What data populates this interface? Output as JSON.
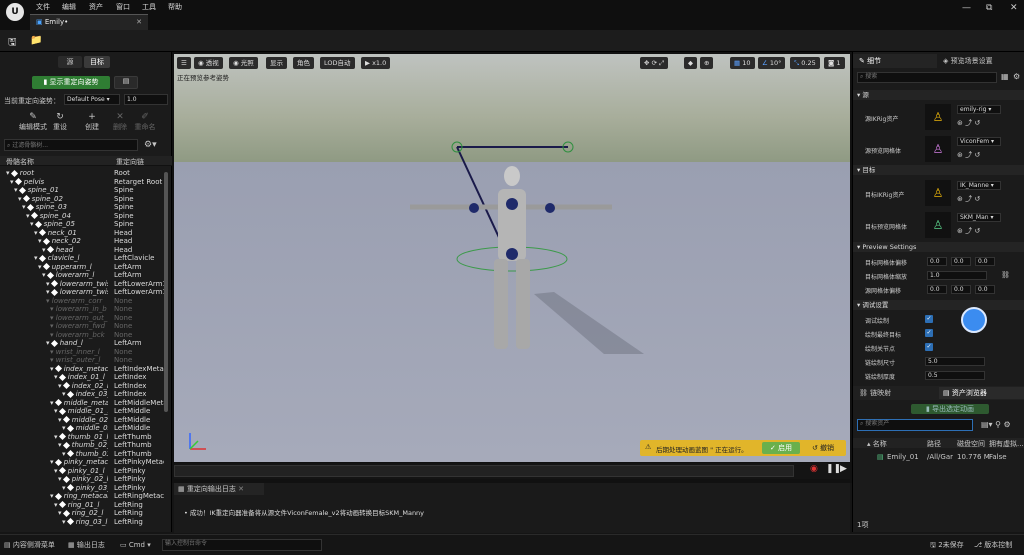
{
  "menu": [
    "文件",
    "编辑",
    "资产",
    "窗口",
    "工具",
    "帮助"
  ],
  "tab": {
    "title": "Emily•"
  },
  "window_controls": [
    "—",
    "⧉",
    "✕"
  ],
  "left": {
    "tabs": [
      "源",
      "目标"
    ],
    "show_pose_button": "显示重定向姿势",
    "current_pose_label": "当前重定向姿势：",
    "current_pose_value": "Default Pose",
    "pose_amount": "1.0",
    "tools": [
      "编辑模式",
      "重设",
      "创建",
      "删除",
      "重命名"
    ],
    "search_placeholder": "过滤骨骼树...",
    "columns": [
      "骨骼名称",
      "重定向链"
    ],
    "bones": [
      {
        "name": "root",
        "chain": "Root",
        "depth": 0,
        "dim": false
      },
      {
        "name": "pelvis",
        "chain": "Retarget Root",
        "depth": 1,
        "dim": false
      },
      {
        "name": "spine_01",
        "chain": "Spine",
        "depth": 2,
        "dim": false
      },
      {
        "name": "spine_02",
        "chain": "Spine",
        "depth": 3,
        "dim": false
      },
      {
        "name": "spine_03",
        "chain": "Spine",
        "depth": 4,
        "dim": false
      },
      {
        "name": "spine_04",
        "chain": "Spine",
        "depth": 5,
        "dim": false
      },
      {
        "name": "spine_05",
        "chain": "Spine",
        "depth": 6,
        "dim": false
      },
      {
        "name": "neck_01",
        "chain": "Head",
        "depth": 7,
        "dim": false
      },
      {
        "name": "neck_02",
        "chain": "Head",
        "depth": 8,
        "dim": false
      },
      {
        "name": "head",
        "chain": "Head",
        "depth": 9,
        "dim": false
      },
      {
        "name": "clavicle_l",
        "chain": "LeftClavicle",
        "depth": 7,
        "dim": false
      },
      {
        "name": "upperarm_l",
        "chain": "LeftArm",
        "depth": 8,
        "dim": false
      },
      {
        "name": "lowerarm_l",
        "chain": "LeftArm",
        "depth": 9,
        "dim": false
      },
      {
        "name": "lowerarm_twist_",
        "chain": "LeftLowerArm1",
        "depth": 10,
        "dim": false
      },
      {
        "name": "lowerarm_twist_",
        "chain": "LeftLowerArm1",
        "depth": 10,
        "dim": false
      },
      {
        "name": "lowerarm_corr",
        "chain": "None",
        "depth": 10,
        "dim": true
      },
      {
        "name": "lowerarm_in_b",
        "chain": "None",
        "depth": 11,
        "dim": true
      },
      {
        "name": "lowerarm_out_",
        "chain": "None",
        "depth": 11,
        "dim": true
      },
      {
        "name": "lowerarm_fwd",
        "chain": "None",
        "depth": 11,
        "dim": true
      },
      {
        "name": "lowerarm_bck",
        "chain": "None",
        "depth": 11,
        "dim": true
      },
      {
        "name": "hand_l",
        "chain": "LeftArm",
        "depth": 10,
        "dim": false
      },
      {
        "name": "wrist_inner_l",
        "chain": "None",
        "depth": 11,
        "dim": true
      },
      {
        "name": "wrist_outer_l",
        "chain": "None",
        "depth": 11,
        "dim": true
      },
      {
        "name": "index_metacar",
        "chain": "LeftIndexMetac",
        "depth": 11,
        "dim": false
      },
      {
        "name": "index_01_l",
        "chain": "LeftIndex",
        "depth": 12,
        "dim": false
      },
      {
        "name": "index_02_l",
        "chain": "LeftIndex",
        "depth": 13,
        "dim": false
      },
      {
        "name": "index_03_l",
        "chain": "LeftIndex",
        "depth": 14,
        "dim": false
      },
      {
        "name": "middle_metac",
        "chain": "LeftMiddleMeta",
        "depth": 11,
        "dim": false
      },
      {
        "name": "middle_01_l",
        "chain": "LeftMiddle",
        "depth": 12,
        "dim": false
      },
      {
        "name": "middle_02_l",
        "chain": "LeftMiddle",
        "depth": 13,
        "dim": false
      },
      {
        "name": "middle_03_l",
        "chain": "LeftMiddle",
        "depth": 14,
        "dim": false
      },
      {
        "name": "thumb_01_l",
        "chain": "LeftThumb",
        "depth": 12,
        "dim": false
      },
      {
        "name": "thumb_02_l",
        "chain": "LeftThumb",
        "depth": 13,
        "dim": false
      },
      {
        "name": "thumb_03_l",
        "chain": "LeftThumb",
        "depth": 14,
        "dim": false
      },
      {
        "name": "pinky_metaca",
        "chain": "LeftPinkyMetac",
        "depth": 11,
        "dim": false
      },
      {
        "name": "pinky_01_l",
        "chain": "LeftPinky",
        "depth": 12,
        "dim": false
      },
      {
        "name": "pinky_02_l",
        "chain": "LeftPinky",
        "depth": 13,
        "dim": false
      },
      {
        "name": "pinky_03_l",
        "chain": "LeftPinky",
        "depth": 14,
        "dim": false
      },
      {
        "name": "ring_metacar",
        "chain": "LeftRingMetac",
        "depth": 11,
        "dim": false
      },
      {
        "name": "ring_01_l",
        "chain": "LeftRing",
        "depth": 12,
        "dim": false
      },
      {
        "name": "ring_02_l",
        "chain": "LeftRing",
        "depth": 13,
        "dim": false
      },
      {
        "name": "ring_03_l",
        "chain": "LeftRing",
        "depth": 14,
        "dim": false
      }
    ]
  },
  "viewport": {
    "buttons": [
      "透视",
      "光照",
      "显示",
      "角色",
      "LOD自动",
      "x1.0"
    ],
    "status": "正在预览参考姿势",
    "right_values": [
      "10",
      "10°",
      "0.25",
      "1"
    ],
    "notice": "后期处理动画蓝图 \" 正在运行。",
    "notice_enable": "启用",
    "notice_cancel": "撤销"
  },
  "log": {
    "tab": "重定向输出日志",
    "message": "成功！IK重定向器准备将从源文件ViconFemale_v2将动画转换目标SKM_Manny"
  },
  "right": {
    "tabs": [
      "细节",
      "预览场景设置"
    ],
    "search_placeholder": "搜索",
    "source_section": "源",
    "source_ik_label": "源IKRig资产",
    "source_ik_value": "emily-rig",
    "source_mesh_label": "源预览网格体",
    "source_mesh_value": "ViconFem",
    "target_section": "目标",
    "target_ik_label": "目标IKRig资产",
    "target_ik_value": "IK_Manne",
    "target_mesh_label": "目标预览网格体",
    "target_mesh_value": "SKM_Man",
    "preview_section": "Preview Settings",
    "preview_rows": [
      {
        "label": "目标网格体偏移",
        "values": [
          "0.0",
          "0.0",
          "0.0"
        ]
      },
      {
        "label": "目标网格体缩放",
        "values": [
          "1.0"
        ]
      },
      {
        "label": "源网格体偏移",
        "values": [
          "0.0",
          "0.0",
          "0.0"
        ]
      }
    ],
    "debug_section": "调试设置",
    "debug_rows": [
      {
        "label": "调试绘制",
        "check": true
      },
      {
        "label": "绘制最终目标",
        "check": true
      },
      {
        "label": "绘制关节点",
        "check": true
      },
      {
        "label": "链绘制尺寸",
        "value": "5.0"
      },
      {
        "label": "链绘制厚度",
        "value": "0.5"
      }
    ],
    "chain_tab": "链映射",
    "asset_tab": "资产浏览器",
    "export_button": "导出选定动画",
    "asset_search_placeholder": "搜索资产",
    "asset_columns": [
      "名称",
      "路径",
      "磁盘空间",
      "拥有虚拟..."
    ],
    "asset_row": {
      "name": "Emily_01",
      "path": "/All/Gar",
      "size": "10.776 M",
      "virtual": "False"
    },
    "count": "1项"
  },
  "statusbar": {
    "content_drawer": "内容侧滑菜单",
    "output_log": "输出日志",
    "cmd": "Cmd",
    "cmd_placeholder": "输入控制台命令",
    "unsaved": "2未保存",
    "source_control": "版本控制"
  }
}
